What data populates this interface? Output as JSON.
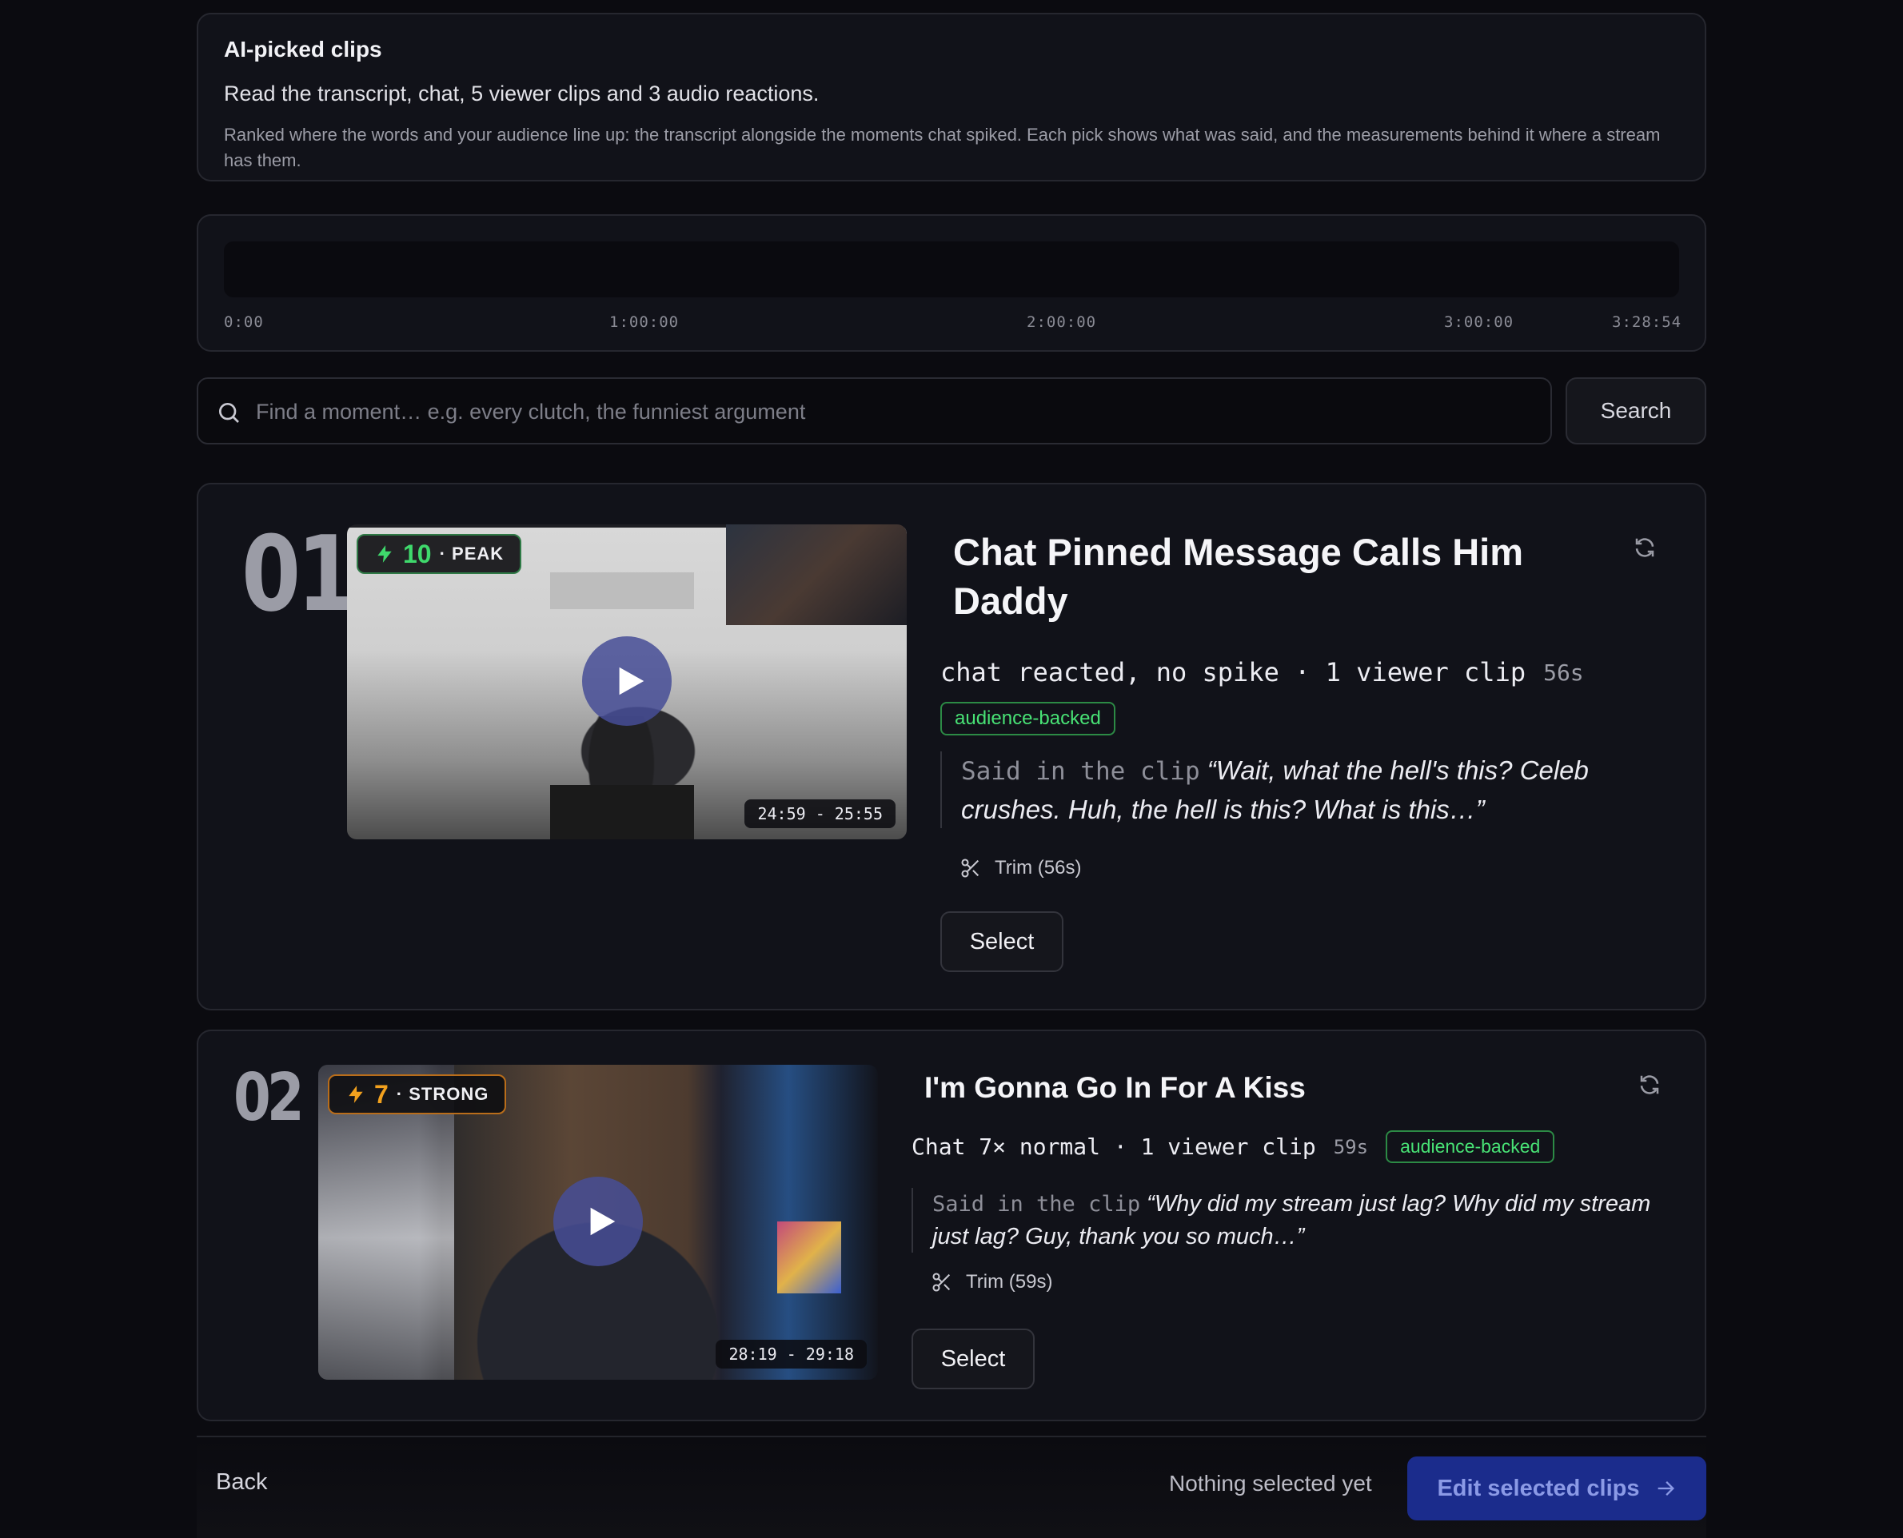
{
  "intro": {
    "title": "AI-picked clips",
    "subtitle": "Read the transcript, chat, 5 viewer clips and 3 audio reactions.",
    "description": "Ranked where the words and your audience line up: the transcript alongside the moments chat spiked. Each pick shows what was said, and the measurements behind it where a stream has them."
  },
  "timeline": {
    "ticks": [
      "0:00",
      "1:00:00",
      "2:00:00",
      "3:00:00",
      "3:28:54"
    ]
  },
  "search": {
    "placeholder": "Find a moment… e.g. every clutch, the funniest argument",
    "value": "",
    "button_label": "Search"
  },
  "clips": [
    {
      "rank": "01",
      "score": "10",
      "level": "· PEAK",
      "score_color": "#3fd96c",
      "time_range": "24:59 - 25:55",
      "title": "Chat Pinned Message Calls Him Daddy",
      "meta": "chat reacted, no spike · 1 viewer clip",
      "duration": "56s",
      "tag": "audience-backed",
      "quote_label": "Said in the clip",
      "quote": "“Wait, what the hell's this? Celeb crushes. Huh, the hell is this? What is this…”",
      "trim_label": "Trim (56s)",
      "select_label": "Select"
    },
    {
      "rank": "02",
      "score": "7",
      "level": "· STRONG",
      "score_color": "#f2a11e",
      "time_range": "28:19 - 29:18",
      "title": "I'm Gonna Go In For A Kiss",
      "meta": "Chat 7× normal · 1 viewer clip",
      "duration": "59s",
      "tag": "audience-backed",
      "quote_label": "Said in the clip",
      "quote": "“Why did my stream just lag? Why did my stream just lag? Guy, thank you so much…”",
      "trim_label": "Trim (59s)",
      "select_label": "Select"
    }
  ],
  "footer": {
    "back_label": "Back",
    "status": "Nothing selected yet",
    "edit_label": "Edit selected clips"
  },
  "colors": {
    "accent": "#1b2c8c",
    "tag_green": "#48e275",
    "peak_green": "#3fd96c",
    "strong_orange": "#f2a11e"
  },
  "icons": [
    "search-icon",
    "bolt-icon",
    "play-icon",
    "refresh-icon",
    "scissors-icon",
    "arrow-right-icon"
  ]
}
